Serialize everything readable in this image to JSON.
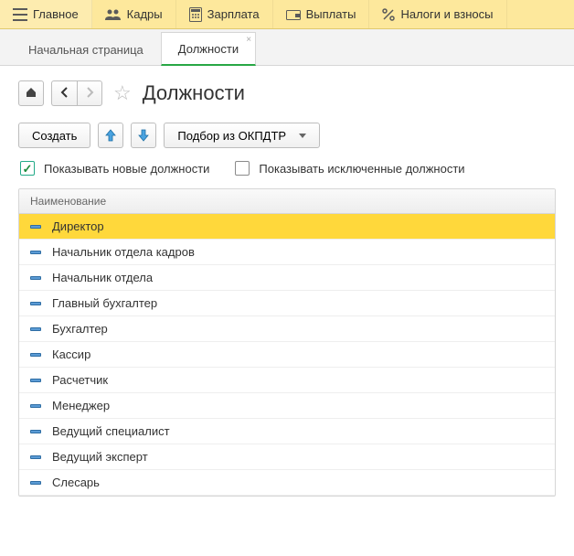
{
  "menu": [
    {
      "id": "main",
      "label": "Главное",
      "icon": "menu"
    },
    {
      "id": "personnel",
      "label": "Кадры",
      "icon": "users"
    },
    {
      "id": "salary",
      "label": "Зарплата",
      "icon": "calc"
    },
    {
      "id": "payments",
      "label": "Выплаты",
      "icon": "wallet"
    },
    {
      "id": "taxes",
      "label": "Налоги и взносы",
      "icon": "percent"
    }
  ],
  "tabs": {
    "home": "Начальная страница",
    "positions": "Должности"
  },
  "page": {
    "title": "Должности"
  },
  "toolbar": {
    "create": "Создать",
    "pick_okpdtr": "Подбор из ОКПДТР"
  },
  "filters": {
    "show_new": {
      "label": "Показывать новые должности",
      "checked": true
    },
    "show_excluded": {
      "label": "Показывать исключенные должности",
      "checked": false
    }
  },
  "table": {
    "header": "Наименование",
    "rows": [
      {
        "name": "Директор",
        "selected": true
      },
      {
        "name": "Начальник отдела кадров",
        "selected": false
      },
      {
        "name": "Начальник отдела",
        "selected": false
      },
      {
        "name": "Главный бухгалтер",
        "selected": false
      },
      {
        "name": "Бухгалтер",
        "selected": false
      },
      {
        "name": "Кассир",
        "selected": false
      },
      {
        "name": "Расчетчик",
        "selected": false
      },
      {
        "name": "Менеджер",
        "selected": false
      },
      {
        "name": "Ведущий специалист",
        "selected": false
      },
      {
        "name": "Ведущий эксперт",
        "selected": false
      },
      {
        "name": "Слесарь",
        "selected": false
      }
    ]
  }
}
